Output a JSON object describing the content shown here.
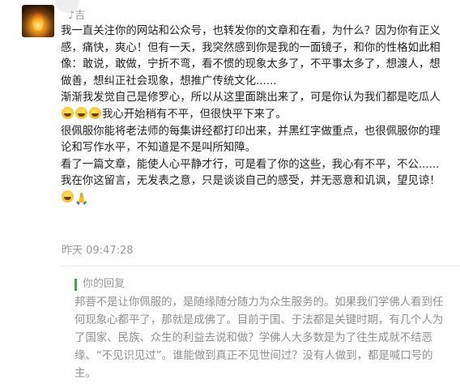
{
  "comment": {
    "username": "♪吉",
    "paragraphs": [
      "我一直关注你的网站和公众号，也转发你的文章和在看，为什么？因为你有正义感，痛快，爽心！但有一天，我突然感到你是我的一面镜子，和你的性格如此相像：敢说，敢做，宁折不弯，看不惯的现象太多了，不平事太多了，想渡人，想做善，想纠正社会现象，想推广传统文化......",
      "渐渐我发觉自己是修罗心，所以从这里面跳出来了，可是你认为我们都是吃瓜人",
      "我心开始稍有不平，但很快平下来了。",
      "很佩服你能将老法师的每集讲经都打印出来，并黑红字做重点，也很佩服你的理论和写作水平，不知道是不是叫所知障。",
      "看了一篇文章，能使人心平静才行，可是看了你的这些，我心有不平，不公......",
      "我在你这留言，无发表之意，只是谈谈自己的感受，并无恶意和讥讽，望见谅！"
    ],
    "emoji_icons": [
      "grinning-face-icon",
      "grinning-face-icon",
      "grinning-face-icon",
      "grinning-face-icon",
      "folded-hands-icon"
    ],
    "timestamp": "昨天 09:47:28"
  },
  "reply": {
    "title": "你的回复",
    "body": "邦菩不是让你佩服的，是随缘随分随力为众生服务的。如果我们学佛人看到任何现象心都平了，那就是成佛了。目前于国、于法都是关键时期，有几个人为了国家、民族、众生的利益去说和做？学佛人大多数是为了往生成就不结恶缘、“不见识见过”。谁能做到真正不见世间过？没有人做到，都是喊口号的主。",
    "accent_color": "#3fa34d"
  }
}
